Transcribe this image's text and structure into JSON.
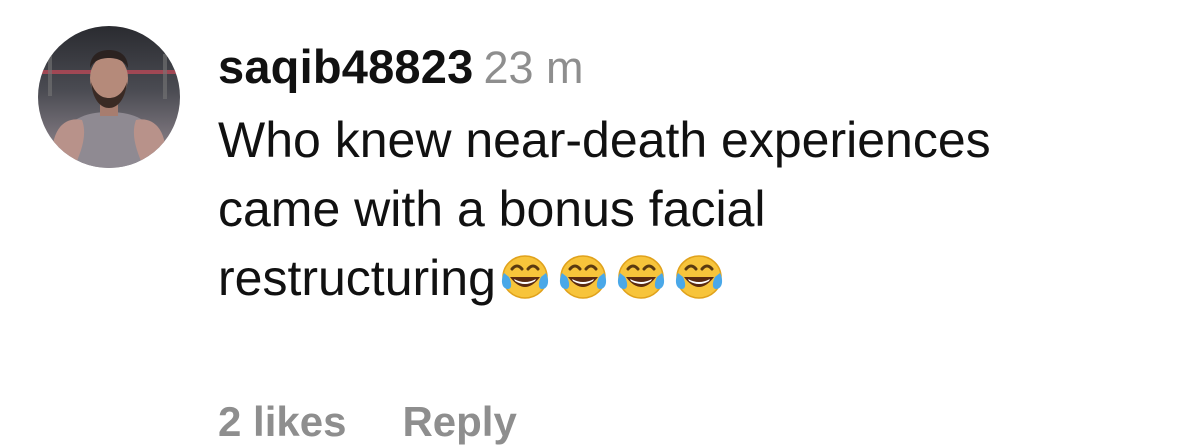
{
  "comment": {
    "username": "saqib48823",
    "timestamp": "23 m",
    "text_line1": "Who knew near-death experiences",
    "text_line2": "came with a bonus facial",
    "text_line3": "restructuring",
    "emojis": [
      "face-with-tears-of-joy-icon",
      "face-with-tears-of-joy-icon",
      "face-with-tears-of-joy-icon",
      "face-with-tears-of-joy-icon"
    ],
    "likes_label": "2 likes",
    "reply_label": "Reply"
  },
  "colors": {
    "text": "#111111",
    "muted": "#8e8e8e",
    "background": "#ffffff"
  }
}
